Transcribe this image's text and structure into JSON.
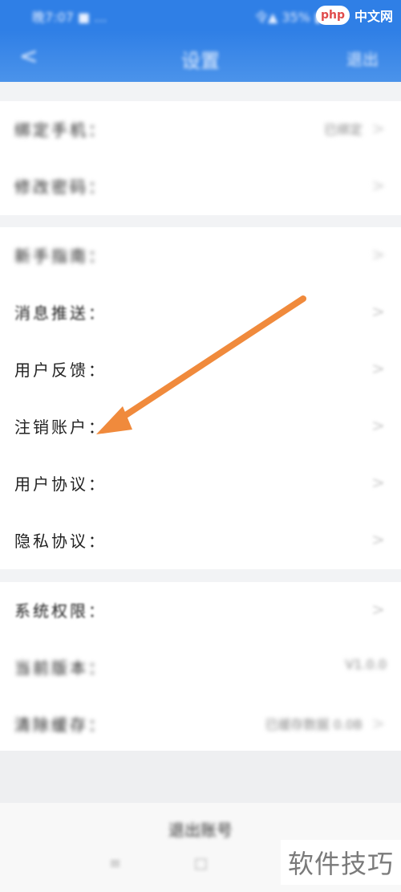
{
  "status_bar": {
    "left": "晚7:07 ■ …",
    "right": "令▲ 35% ▮"
  },
  "watermark_top": {
    "logo": "php",
    "text": "中文网"
  },
  "nav": {
    "back": "<",
    "title": "设置",
    "right": "退出"
  },
  "groups": [
    {
      "rows": [
        {
          "label": "绑定手机：",
          "value": "已绑定",
          "chevron": ">"
        },
        {
          "label": "修改密码：",
          "value": "",
          "chevron": ">"
        }
      ]
    },
    {
      "rows": [
        {
          "label": "新手指南：",
          "value": "",
          "chevron": ">"
        },
        {
          "label": "消息推送：",
          "value": "",
          "chevron": ">"
        },
        {
          "label": "用户反馈：",
          "value": "",
          "chevron": ">"
        },
        {
          "label": "注销账户：",
          "value": "",
          "chevron": ">"
        },
        {
          "label": "用户协议：",
          "value": "",
          "chevron": ">"
        },
        {
          "label": "隐私协议：",
          "value": "",
          "chevron": ">"
        }
      ]
    },
    {
      "rows": [
        {
          "label": "系统权限：",
          "value": "",
          "chevron": ">"
        },
        {
          "label": "当前版本：",
          "value": "V1.0.0",
          "chevron": ""
        },
        {
          "label": "清除缓存：",
          "value": "已缓存数据 0.0B",
          "chevron": ">"
        }
      ]
    }
  ],
  "logout": "退出账号",
  "watermark_bottom": "软件技巧",
  "colors": {
    "accent": "#2f7fe6",
    "arrow": "#f08a3c"
  }
}
